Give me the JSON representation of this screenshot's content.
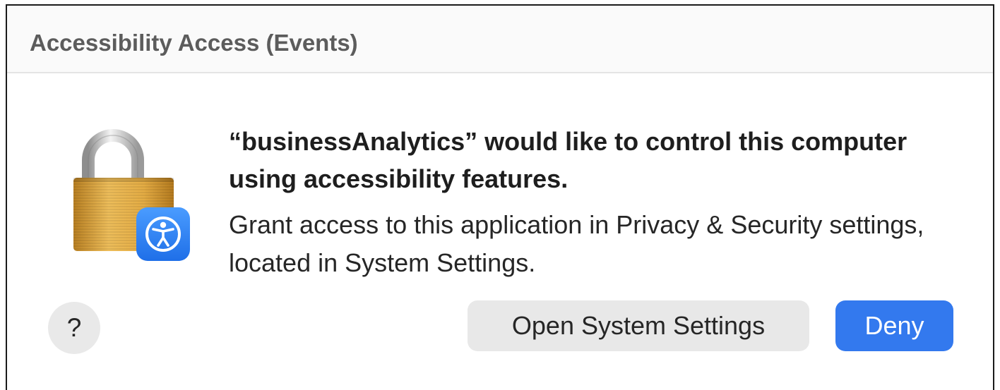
{
  "dialog": {
    "title": "Accessibility Access (Events)",
    "headline": "“businessAnalytics” would like to control this computer using accessibility features.",
    "message": "Grant access to this application in Privacy & Security settings, located in System Settings.",
    "icon": "lock-icon",
    "badge_icon": "accessibility-icon"
  },
  "buttons": {
    "help_label": "?",
    "open_settings_label": "Open System Settings",
    "deny_label": "Deny"
  },
  "colors": {
    "primary_button": "#3379ee",
    "secondary_button": "#e8e8e8",
    "lock_gold": "#e0a93e",
    "badge_blue": "#2a7ff4"
  }
}
